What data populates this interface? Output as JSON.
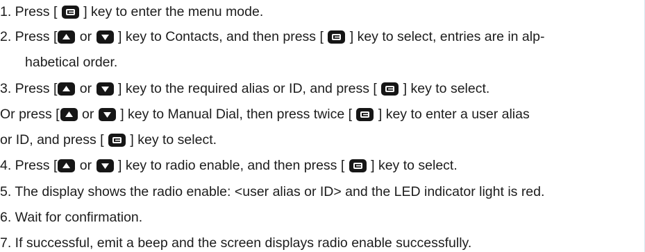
{
  "lines": [
    {
      "pre": "1. Press [ ",
      "post": " ] key to enter the menu mode."
    },
    {
      "pre": "2. Press [",
      "mid": " or ",
      "post1": " ] key to Contacts, and then press [ ",
      "post2": " ] key to select, entries are in alp-"
    },
    {
      "text": "habetical order."
    },
    {
      "pre": "3. Press [",
      "mid": " or ",
      "post1": " ] key to the required alias or ID, and press [ ",
      "post2": " ] key to select."
    },
    {
      "pre": "Or press [",
      "mid": " or ",
      "post1": " ] key to Manual Dial, then press twice [ ",
      "post2": " ] key to enter a user alias"
    },
    {
      "pre": "or ID, and press [ ",
      "post": " ] key to select."
    },
    {
      "pre": "4. Press [",
      "mid": " or ",
      "post1": " ] key to radio enable, and then press [ ",
      "post2": " ] key to select."
    },
    {
      "text": "5. The display shows the radio enable: <user alias or ID> and the LED indicator light is red."
    },
    {
      "text": "6. Wait for confirmation."
    },
    {
      "text": "7. If successful, emit a beep and the screen displays radio enable successfully."
    }
  ],
  "icons": {
    "menu_key": "menu-key-icon",
    "up_key": "up-arrow-key-icon",
    "down_key": "down-arrow-key-icon"
  },
  "colors": {
    "text": "#1c1c1c",
    "key": "#161616",
    "right_rule": "#d6e6ef"
  }
}
